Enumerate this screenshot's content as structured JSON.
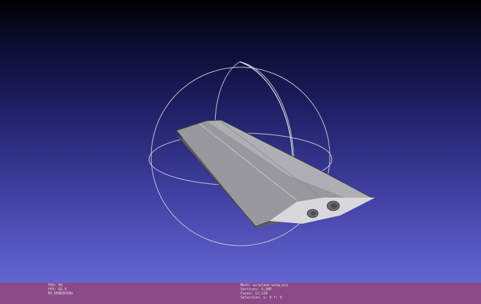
{
  "viewport": {
    "background_top": "#000000",
    "background_bottom": "#6565d2",
    "trackball_color": "#c9c9d6",
    "mesh_color": "#a8a8ac"
  },
  "status_bar": {
    "color": "#8a4a88",
    "left_info": [
      "FOV: 60",
      "FPS:   82.6",
      "BO_RENDERING"
    ],
    "right_info": [
      "Mesh: airplane_wing.ply",
      "Vertices: 6,380",
      "Faces: 12,128",
      "Selection: v: 0 f: 0"
    ]
  }
}
